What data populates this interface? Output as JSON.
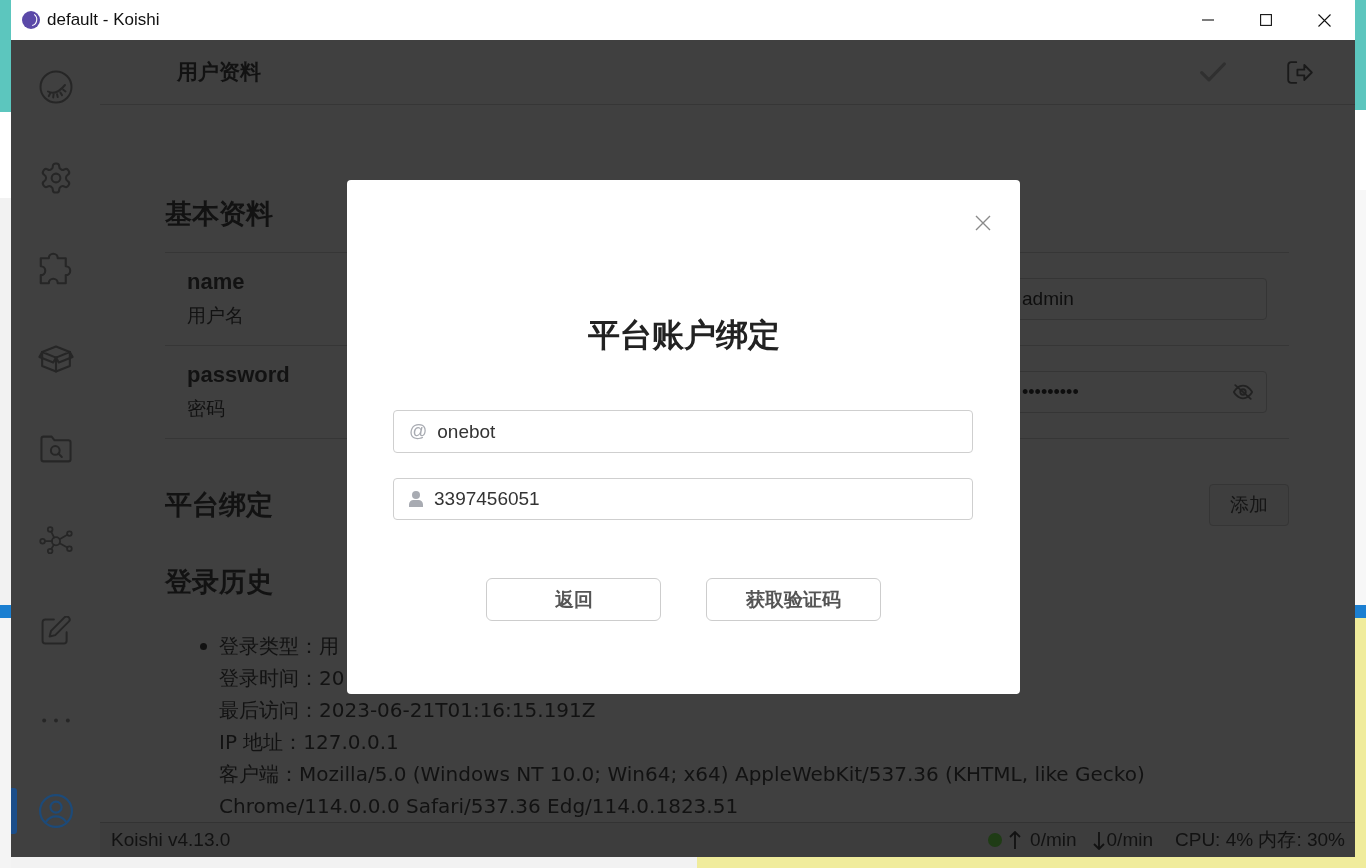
{
  "window": {
    "title": "default - Koishi"
  },
  "sidebar": {
    "items": [
      {
        "kind": "logo",
        "selected": false
      },
      {
        "kind": "gear",
        "selected": false
      },
      {
        "kind": "puzzle",
        "selected": false
      },
      {
        "kind": "box",
        "selected": false
      },
      {
        "kind": "folder-search",
        "selected": false
      },
      {
        "kind": "nodes",
        "selected": false
      },
      {
        "kind": "pencil",
        "selected": false
      },
      {
        "kind": "dots",
        "selected": false
      },
      {
        "kind": "user",
        "selected": true
      }
    ]
  },
  "header": {
    "title": "用户资料",
    "actions": [
      {
        "kind": "check",
        "disabled": true
      },
      {
        "kind": "logout",
        "disabled": false
      }
    ]
  },
  "basic_info": {
    "title": "基本资料",
    "fields": [
      {
        "kind": "text",
        "name": "name",
        "description": "用户名",
        "value": "admin"
      },
      {
        "kind": "password",
        "name": "password",
        "description": "密码",
        "value": "•••••••••"
      }
    ]
  },
  "platform_binding": {
    "title": "平台绑定",
    "add_button": "添加"
  },
  "login_history": {
    "title": "登录历史",
    "entries": [
      {
        "lines": [
          "登录类型：用",
          "登录时间：20",
          "最后访问：2023-06-21T01:16:15.191Z",
          "IP 地址：127.0.0.1",
          "客户端：Mozilla/5.0 (Windows NT 10.0; Win64; x64) AppleWebKit/537.36 (KHTML, like Gecko) Chrome/114.0.0.0 Safari/537.36 Edg/114.0.1823.51"
        ]
      }
    ]
  },
  "dialog": {
    "title": "平台账户绑定",
    "fields": [
      {
        "kind": "prefix",
        "prefix": "@",
        "value": "onebot"
      },
      {
        "kind": "user",
        "value": "3397456051"
      }
    ],
    "buttons": [
      "返回",
      "获取验证码"
    ]
  },
  "status_bar": {
    "version": "Koishi v4.13.0",
    "sent": "0/min",
    "received": "0/min",
    "usage": "CPU: 4% 内存: 30%"
  }
}
